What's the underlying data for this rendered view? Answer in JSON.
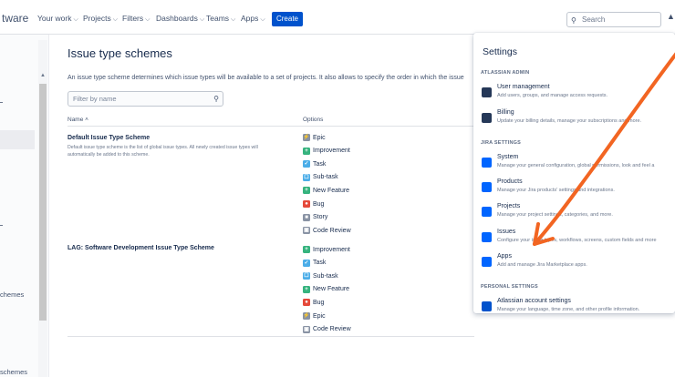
{
  "topnav": {
    "brand": "tware",
    "items": [
      {
        "label": "Your work"
      },
      {
        "label": "Projects"
      },
      {
        "label": "Filters"
      },
      {
        "label": "Dashboards"
      },
      {
        "label": "Teams"
      },
      {
        "label": "Apps"
      }
    ],
    "create_label": "Create",
    "search_placeholder": "Search"
  },
  "sidebar": {
    "labels": [
      "chemes",
      "schemes"
    ]
  },
  "main": {
    "title": "Issue type schemes",
    "description": "An issue type scheme determines which issue types will be available to a set of projects. It also allows to specify the order in which the issue",
    "filter_placeholder": "Filter by name",
    "col_name": "Name ˄",
    "col_options": "Options",
    "schemes": [
      {
        "name": "Default Issue Type Scheme",
        "description": "Default issue type scheme is the list of global issue types. All newly created issue types will automatically be added to this scheme.",
        "options": [
          {
            "label": "Epic",
            "type": "epic"
          },
          {
            "label": "Improvement",
            "type": "improvement"
          },
          {
            "label": "Task",
            "type": "task"
          },
          {
            "label": "Sub-task",
            "type": "subtask"
          },
          {
            "label": "New Feature",
            "type": "feature"
          },
          {
            "label": "Bug",
            "type": "bug"
          },
          {
            "label": "Story",
            "type": "story"
          },
          {
            "label": "Code Review",
            "type": "review"
          }
        ]
      },
      {
        "name": "LAG: Software Development Issue Type Scheme",
        "description": "",
        "options": [
          {
            "label": "Improvement",
            "type": "improvement"
          },
          {
            "label": "Task",
            "type": "task"
          },
          {
            "label": "Sub-task",
            "type": "subtask"
          },
          {
            "label": "New Feature",
            "type": "feature"
          },
          {
            "label": "Bug",
            "type": "bug"
          },
          {
            "label": "Epic",
            "type": "epic"
          },
          {
            "label": "Code Review",
            "type": "review"
          }
        ]
      }
    ]
  },
  "settings": {
    "title": "Settings",
    "sections": [
      {
        "heading": "ATLASSIAN ADMIN",
        "items": [
          {
            "title": "User management",
            "subtitle": "Add users, groups, and manage access requests."
          },
          {
            "title": "Billing",
            "subtitle": "Update your billing details, manage your subscriptions and more."
          }
        ]
      },
      {
        "heading": "JIRA SETTINGS",
        "items": [
          {
            "title": "System",
            "subtitle": "Manage your general configuration, global permissions, look and feel a"
          },
          {
            "title": "Products",
            "subtitle": "Manage your Jira products' settings and integrations."
          },
          {
            "title": "Projects",
            "subtitle": "Manage your project settings, categories, and more."
          },
          {
            "title": "Issues",
            "subtitle": "Configure your issue types, workflows, screens, custom fields and more"
          },
          {
            "title": "Apps",
            "subtitle": "Add and manage Jira Marketplace apps."
          }
        ]
      },
      {
        "heading": "PERSONAL SETTINGS",
        "items": [
          {
            "title": "Atlassian account settings",
            "subtitle": "Manage your language, time zone, and other profile information."
          }
        ]
      }
    ]
  },
  "icon_colors": {
    "epic": "#8993a4",
    "improvement": "#36b37e",
    "task": "#4bade8",
    "subtask": "#4bade8",
    "feature": "#36b37e",
    "bug": "#e5493a",
    "story": "#8993a4",
    "review": "#8993a4"
  },
  "annotation_color": "#f26522"
}
